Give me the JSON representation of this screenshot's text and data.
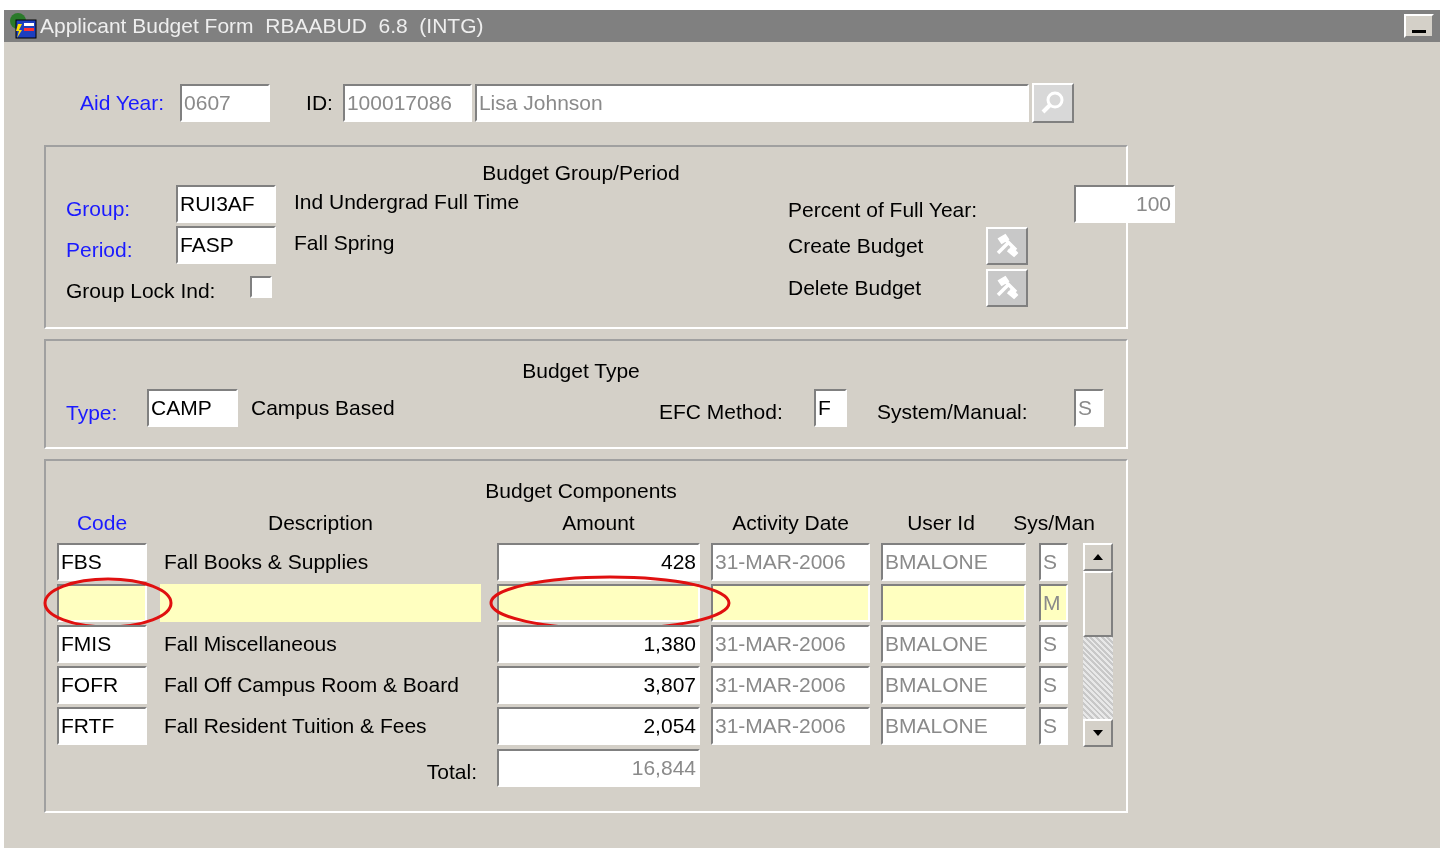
{
  "window": {
    "title": "Applicant Budget Form  RBAABUD  6.8  (INTG)"
  },
  "key_block": {
    "aid_year": {
      "label": "Aid Year:",
      "key": true,
      "value": "0607",
      "disabled": true
    },
    "id": {
      "label": "ID:",
      "key": false,
      "value": "100017086",
      "disabled": true
    },
    "name": {
      "value": "Lisa Johnson",
      "disabled": true
    }
  },
  "group_period": {
    "title": "Budget Group/Period",
    "group": {
      "label": "Group:",
      "key": true,
      "value": "RUI3AF",
      "disabled": false,
      "description": "Ind Undergrad Full Time"
    },
    "period": {
      "label": "Period:",
      "key": true,
      "value": "FASP",
      "disabled": false,
      "description": "Fall Spring"
    },
    "lock": {
      "label": "Group Lock Ind:",
      "checked": false
    },
    "percent": {
      "label": "Percent of Full Year:",
      "value": "100",
      "disabled": true
    },
    "buttons": [
      {
        "label": "Create Budget"
      },
      {
        "label": "Delete Budget"
      }
    ]
  },
  "budget_type": {
    "title": "Budget Type",
    "type": {
      "label": "Type:",
      "key": true,
      "value": "CAMP",
      "disabled": false,
      "description": "Campus Based"
    },
    "efc_method": {
      "label": "EFC Method:",
      "value": "F",
      "disabled": false
    },
    "system_manual": {
      "label": "System/Manual:",
      "value": "S",
      "disabled": true
    }
  },
  "components": {
    "title": "Budget Components",
    "columns": [
      {
        "label": "Code",
        "key": true,
        "kind": "field",
        "disabled": false
      },
      {
        "label": "Description",
        "key": false,
        "kind": "text",
        "disabled": false
      },
      {
        "label": "Amount",
        "key": false,
        "kind": "field",
        "disabled": false
      },
      {
        "label": "Activity Date",
        "key": false,
        "kind": "field",
        "disabled": true
      },
      {
        "label": "User Id",
        "key": false,
        "kind": "field",
        "disabled": true
      },
      {
        "label": "Sys/Man",
        "key": false,
        "kind": "field",
        "disabled": true
      }
    ],
    "rows": [
      {
        "code": "FBS",
        "description": "Fall Books & Supplies",
        "amount": "428",
        "activity_date": "31-MAR-2006",
        "user_id": "BMALONE",
        "sys_man": "S",
        "selected": false,
        "circled": false
      },
      {
        "sys_man": "M",
        "selected": true,
        "circled": true
      },
      {
        "code": "FMIS",
        "description": "Fall Miscellaneous",
        "amount": "1,380",
        "activity_date": "31-MAR-2006",
        "user_id": "BMALONE",
        "sys_man": "S",
        "selected": false,
        "circled": false
      },
      {
        "code": "FOFR",
        "description": "Fall Off Campus Room & Board",
        "amount": "3,807",
        "activity_date": "31-MAR-2006",
        "user_id": "BMALONE",
        "sys_man": "S",
        "selected": false,
        "circled": false
      },
      {
        "code": "FRTF",
        "description": "Fall Resident Tuition & Fees",
        "amount": "2,054",
        "activity_date": "31-MAR-2006",
        "user_id": "BMALONE",
        "sys_man": "S",
        "selected": false,
        "circled": false
      }
    ],
    "total": {
      "label": "Total:",
      "value": "16,844",
      "disabled": true
    }
  }
}
